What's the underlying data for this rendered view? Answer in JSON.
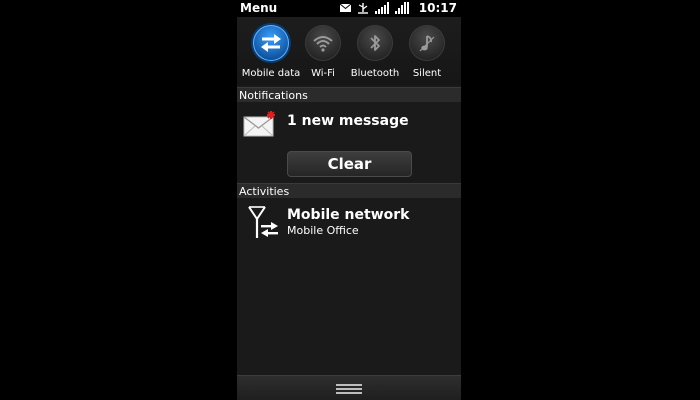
{
  "status_bar": {
    "menu_label": "Menu",
    "time": "10:17",
    "icons": [
      "envelope-icon",
      "usb-icon",
      "signal-icon",
      "battery-icon"
    ]
  },
  "toggles": [
    {
      "label": "Mobile data",
      "icon": "data-transfer-icon",
      "active": true
    },
    {
      "label": "Wi-Fi",
      "icon": "wifi-icon",
      "active": false
    },
    {
      "label": "Bluetooth",
      "icon": "bluetooth-icon",
      "active": false
    },
    {
      "label": "Silent",
      "icon": "silent-icon",
      "active": false
    }
  ],
  "notifications": {
    "header": "Notifications",
    "item_text": "1 new message",
    "item_icon": "envelope-icon",
    "clear_label": "Clear"
  },
  "activities": {
    "header": "Activities",
    "item_title": "Mobile network",
    "item_subtitle": "Mobile Office",
    "item_icon": "network-antenna-icon"
  },
  "bottom_bar": {
    "icon": "drag-handle-icon"
  },
  "colors": {
    "accent": "#2a8cf0",
    "background": "#1a1a1a",
    "header_bg": "#2b2b2b",
    "unread_badge": "#e02020"
  }
}
